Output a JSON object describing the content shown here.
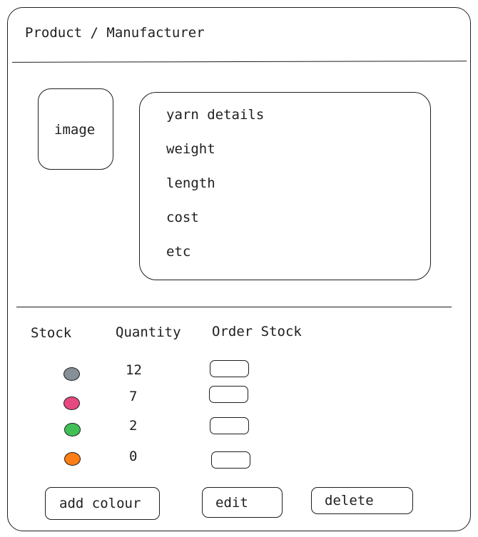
{
  "header": {
    "title": "Product / Manufacturer"
  },
  "product": {
    "image_label": "image",
    "details": [
      "yarn details",
      "weight",
      "length",
      "cost",
      "etc"
    ]
  },
  "stock": {
    "headers": {
      "stock": "Stock",
      "quantity": "Quantity",
      "order": "Order Stock"
    },
    "rows": [
      {
        "color": "#868e96",
        "quantity": "12"
      },
      {
        "color": "#e64980",
        "quantity": "7"
      },
      {
        "color": "#40c057",
        "quantity": "2"
      },
      {
        "color": "#fd7e14",
        "quantity": "0"
      }
    ]
  },
  "actions": {
    "add_colour": "add colour",
    "edit": "edit",
    "delete": "delete"
  }
}
